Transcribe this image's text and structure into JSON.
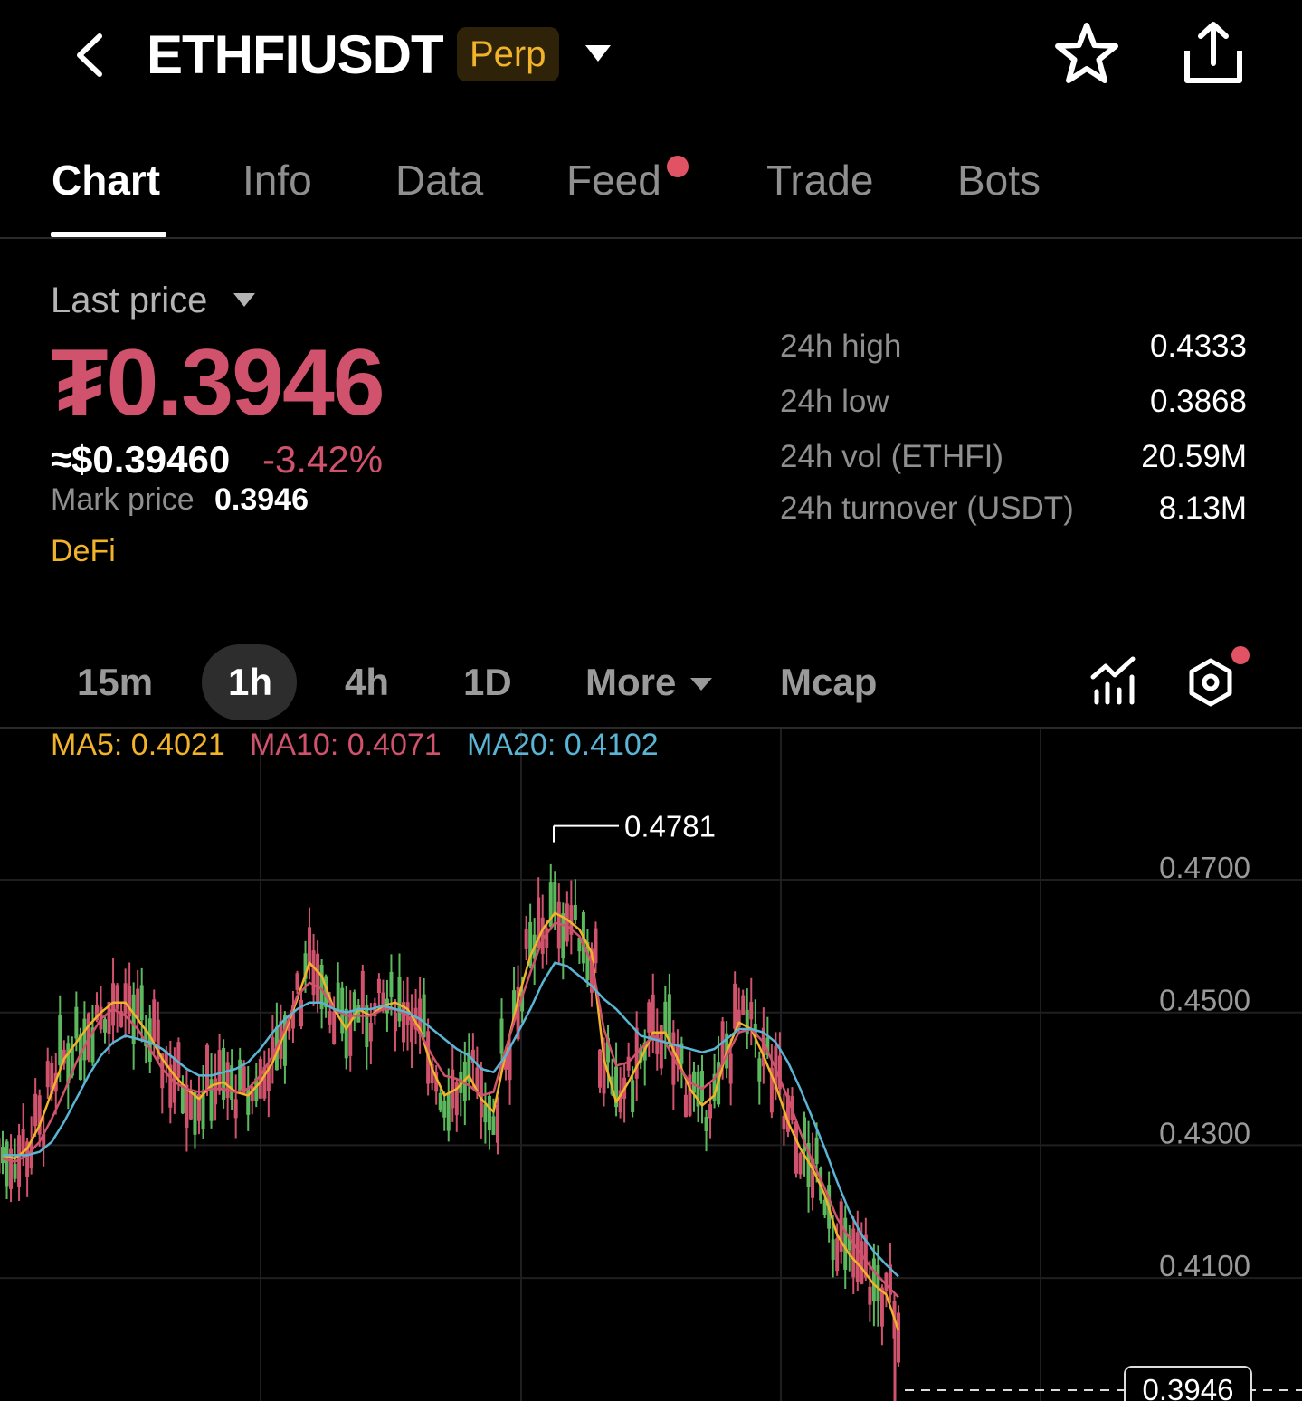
{
  "header": {
    "symbol": "ETHFIUSDT",
    "badge": "Perp",
    "back_icon": "chevron-left-icon",
    "favorite_icon": "star-outline-icon",
    "share_icon": "share-icon"
  },
  "tabs": [
    {
      "label": "Chart",
      "active": true
    },
    {
      "label": "Info",
      "active": false
    },
    {
      "label": "Data",
      "active": false
    },
    {
      "label": "Feed",
      "active": false,
      "notification_dot": true
    },
    {
      "label": "Trade",
      "active": false
    },
    {
      "label": "Bots",
      "active": false
    }
  ],
  "price": {
    "label": "Last price",
    "value": "₮0.3946",
    "usd_value": "≈$0.39460",
    "change": "-3.42%",
    "mark_label": "Mark price",
    "mark_value": "0.3946",
    "sector": "DeFi"
  },
  "stats": [
    {
      "label": "24h high",
      "value": "0.4333"
    },
    {
      "label": "24h low",
      "value": "0.3868"
    },
    {
      "label": "24h vol (ETHFI)",
      "value": "20.59M"
    },
    {
      "label": "24h turnover (USDT)",
      "value": "8.13M"
    }
  ],
  "intervals": {
    "items": [
      "15m",
      "1h",
      "4h",
      "1D",
      "More",
      "Mcap"
    ],
    "selected": "1h"
  },
  "ma_legend": {
    "ma5": "MA5: 0.4021",
    "ma10": "MA10: 0.4071",
    "ma20": "MA20: 0.4102"
  },
  "colors": {
    "up": "#5cb85c",
    "down": "#d0526c",
    "ma5": "#f0b329",
    "ma10": "#d0526c",
    "ma20": "#5ab4d4",
    "accent": "#f0b329"
  },
  "chart_data": {
    "type": "line",
    "title": "",
    "interval": "1h",
    "y_ticks": [
      "0.4700",
      "0.4500",
      "0.4300",
      "0.4100"
    ],
    "ylim": [
      0.3946,
      0.48
    ],
    "peak_label": "0.4781",
    "peak_value": 0.4781,
    "current_price_label": "0.3946",
    "current_price": 0.3946,
    "grid": true,
    "series": [
      {
        "name": "MA5",
        "values": [
          0.4285,
          0.428,
          0.4295,
          0.433,
          0.438,
          0.443,
          0.4455,
          0.448,
          0.45,
          0.4515,
          0.4515,
          0.449,
          0.4465,
          0.443,
          0.4405,
          0.4385,
          0.437,
          0.439,
          0.4395,
          0.438,
          0.4375,
          0.4395,
          0.4425,
          0.447,
          0.452,
          0.4575,
          0.4555,
          0.4505,
          0.4475,
          0.4505,
          0.4495,
          0.451,
          0.4515,
          0.4505,
          0.4475,
          0.4415,
          0.4375,
          0.4385,
          0.4405,
          0.437,
          0.435,
          0.444,
          0.452,
          0.4585,
          0.4625,
          0.465,
          0.464,
          0.4625,
          0.459,
          0.443,
          0.4365,
          0.4395,
          0.443,
          0.447,
          0.447,
          0.443,
          0.4385,
          0.436,
          0.4375,
          0.444,
          0.4485,
          0.4475,
          0.4435,
          0.439,
          0.4335,
          0.4295,
          0.4265,
          0.4225,
          0.4165,
          0.4135,
          0.4115,
          0.409,
          0.4075,
          0.4021
        ]
      },
      {
        "name": "MA10",
        "values": [
          0.428,
          0.4275,
          0.4285,
          0.4305,
          0.434,
          0.438,
          0.4425,
          0.446,
          0.449,
          0.4505,
          0.4495,
          0.4475,
          0.4445,
          0.4415,
          0.4395,
          0.4385,
          0.438,
          0.4385,
          0.4385,
          0.438,
          0.4385,
          0.4405,
          0.4435,
          0.4475,
          0.4525,
          0.4545,
          0.4535,
          0.4505,
          0.4495,
          0.4495,
          0.4495,
          0.4505,
          0.4505,
          0.4495,
          0.447,
          0.4435,
          0.4405,
          0.44,
          0.439,
          0.4375,
          0.438,
          0.4445,
          0.4505,
          0.456,
          0.461,
          0.4635,
          0.463,
          0.4615,
          0.4575,
          0.4475,
          0.442,
          0.4425,
          0.4445,
          0.4465,
          0.4455,
          0.442,
          0.4395,
          0.4385,
          0.44,
          0.4435,
          0.447,
          0.4475,
          0.4455,
          0.4415,
          0.437,
          0.432,
          0.4275,
          0.4235,
          0.419,
          0.416,
          0.4135,
          0.411,
          0.409,
          0.4071
        ]
      },
      {
        "name": "MA20",
        "values": [
          0.4285,
          0.4285,
          0.4285,
          0.429,
          0.4305,
          0.4335,
          0.437,
          0.4405,
          0.4435,
          0.4455,
          0.4465,
          0.446,
          0.4455,
          0.4445,
          0.443,
          0.4415,
          0.4405,
          0.4405,
          0.441,
          0.4415,
          0.4425,
          0.4445,
          0.447,
          0.449,
          0.4505,
          0.4515,
          0.4515,
          0.4505,
          0.45,
          0.4505,
          0.4505,
          0.451,
          0.4505,
          0.45,
          0.449,
          0.4475,
          0.446,
          0.4445,
          0.4435,
          0.4415,
          0.441,
          0.4435,
          0.447,
          0.4505,
          0.4545,
          0.4575,
          0.457,
          0.4555,
          0.454,
          0.452,
          0.4505,
          0.4485,
          0.4465,
          0.446,
          0.4455,
          0.445,
          0.4445,
          0.444,
          0.4445,
          0.446,
          0.4475,
          0.4475,
          0.447,
          0.4455,
          0.4425,
          0.4385,
          0.434,
          0.4295,
          0.4245,
          0.42,
          0.4165,
          0.414,
          0.412,
          0.4102
        ]
      }
    ]
  }
}
